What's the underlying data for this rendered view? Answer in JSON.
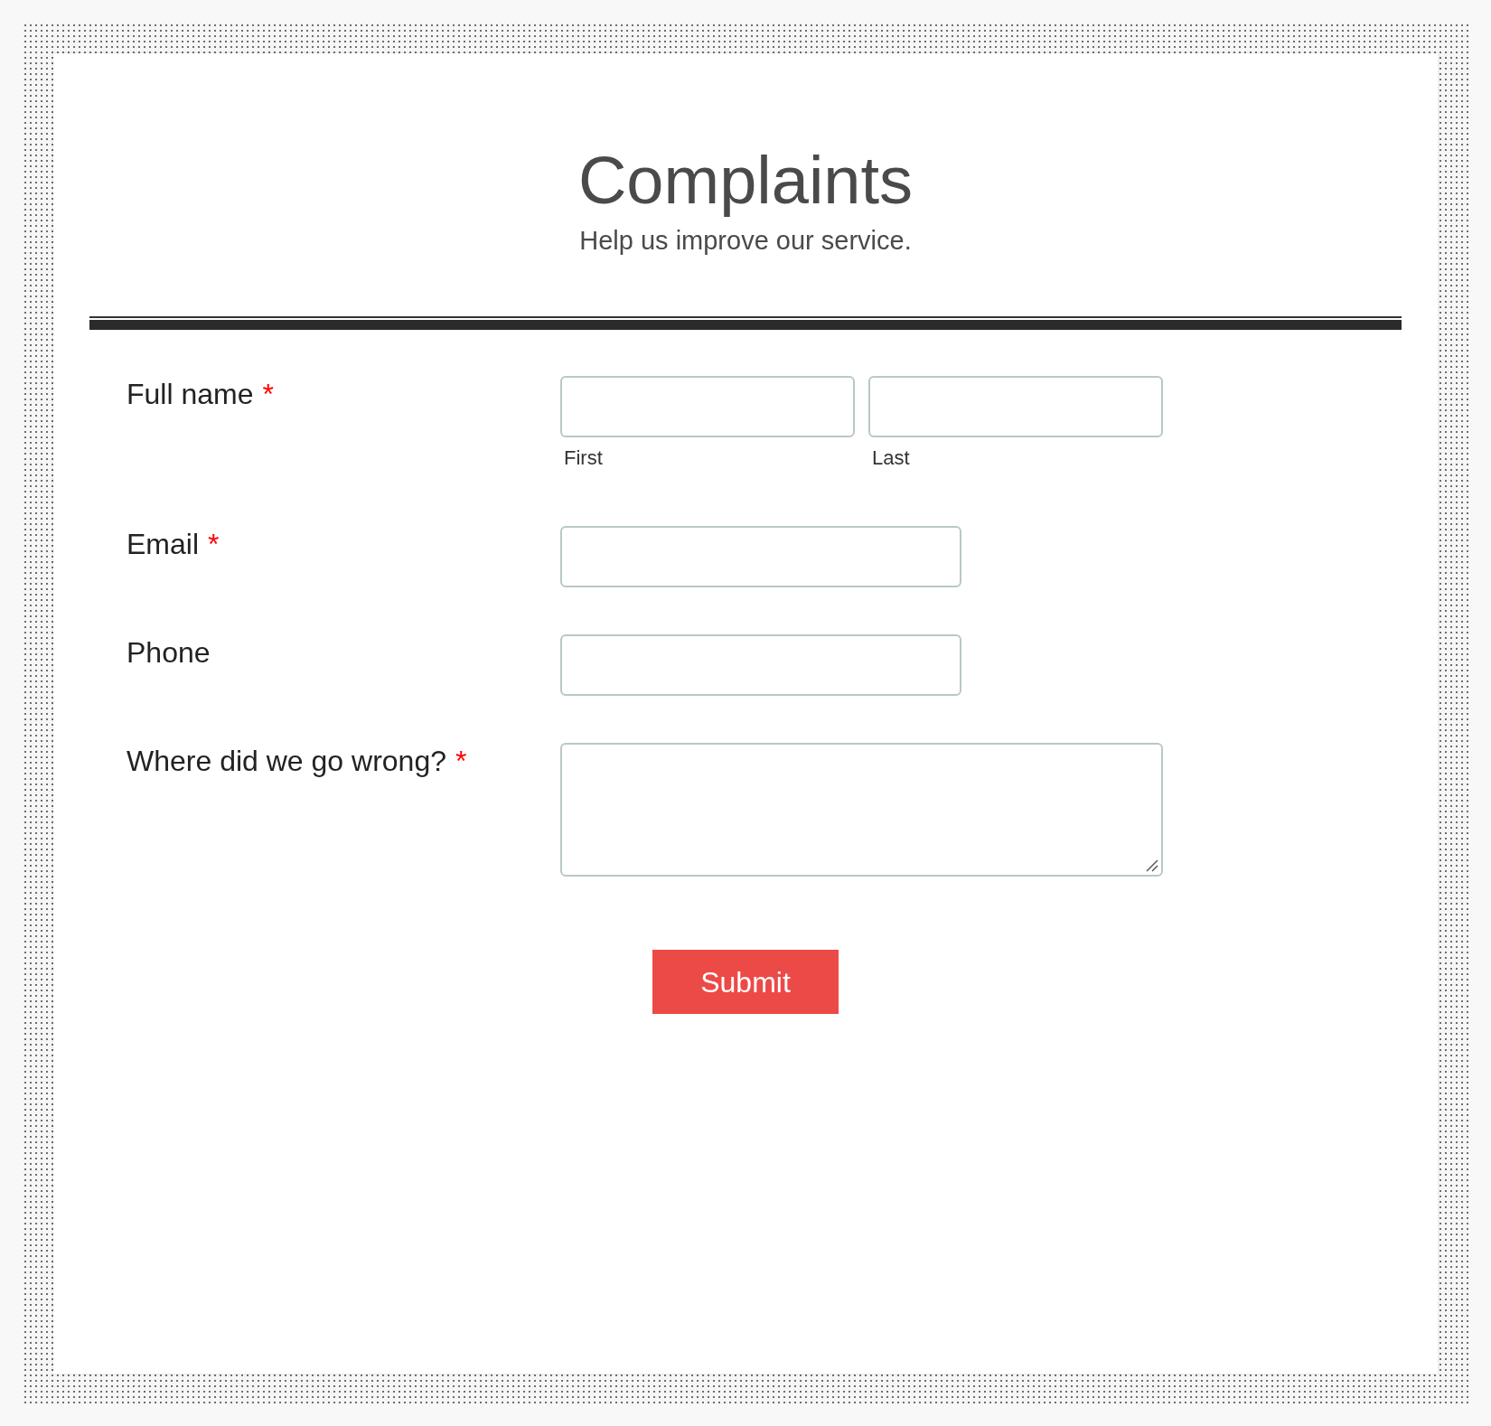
{
  "form": {
    "title": "Complaints",
    "subtitle": "Help us improve our service."
  },
  "required_mark": "*",
  "fields": [
    {
      "kind": "name",
      "label": "Full name",
      "required": true,
      "parts": [
        {
          "sublabel": "First"
        },
        {
          "sublabel": "Last"
        }
      ]
    },
    {
      "kind": "text",
      "label": "Email",
      "required": true
    },
    {
      "kind": "text",
      "label": "Phone",
      "required": false
    },
    {
      "kind": "textarea",
      "label": "Where did we go wrong?",
      "required": true
    }
  ],
  "submit": {
    "label": "Submit"
  }
}
